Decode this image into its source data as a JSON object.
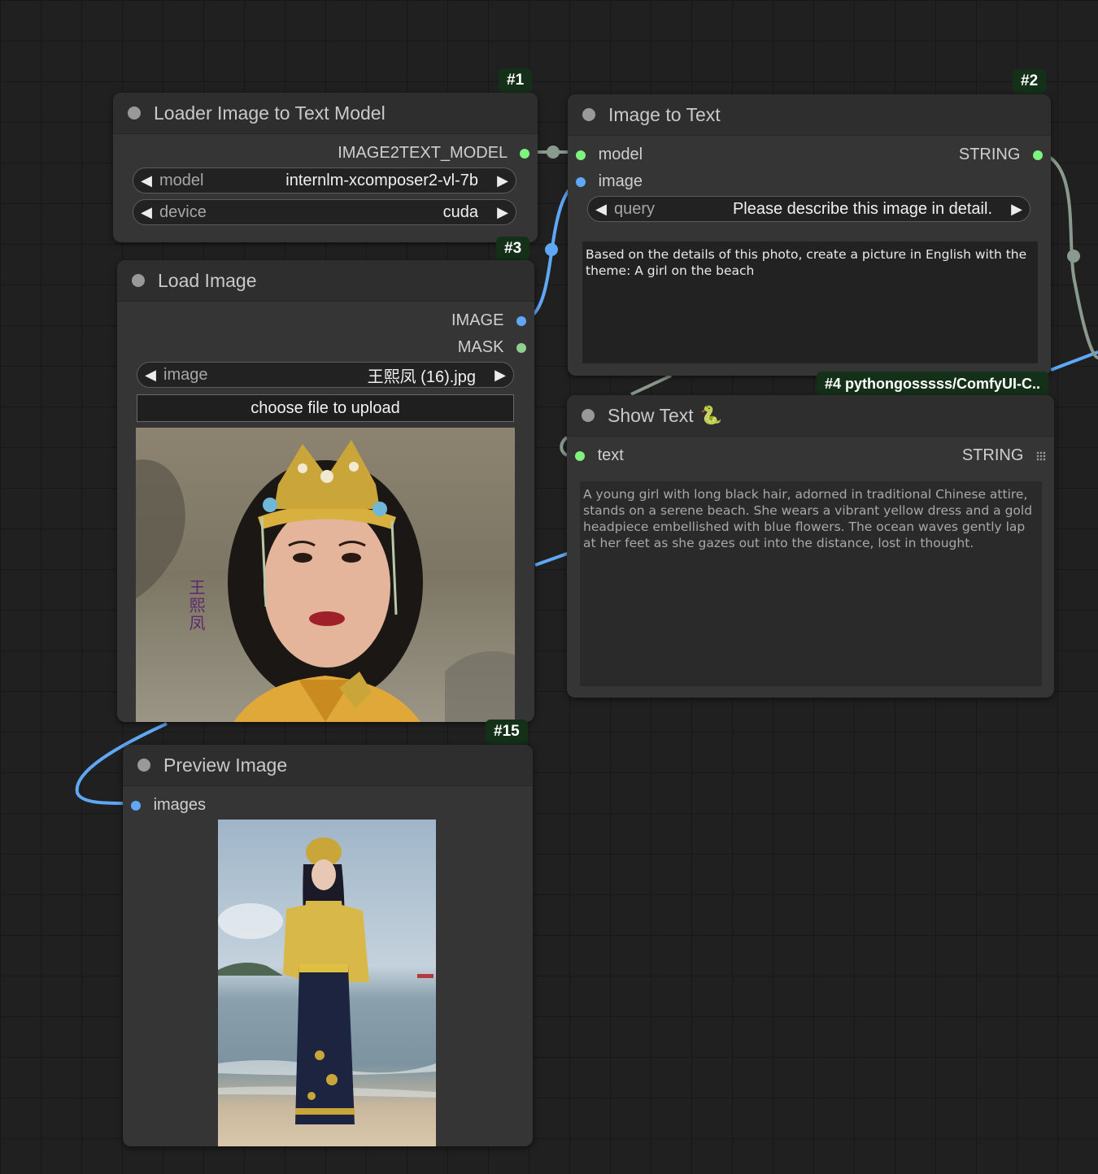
{
  "nodes": {
    "loader": {
      "id": "#1",
      "title": "Loader Image to Text Model",
      "output": "IMAGE2TEXT_MODEL",
      "widgets": [
        {
          "label": "model",
          "value": "internlm-xcomposer2-vl-7b"
        },
        {
          "label": "device",
          "value": "cuda"
        }
      ]
    },
    "image_to_text": {
      "id": "#2",
      "title": "Image to Text",
      "inputs": [
        "model",
        "image"
      ],
      "output": "STRING",
      "query_label": "query",
      "query_value": "Please describe this image in detail.",
      "prompt": "Based on the details of this photo, create a picture in English with the theme: A girl on the beach"
    },
    "load_image": {
      "id": "#3",
      "title": "Load Image",
      "outputs": [
        "IMAGE",
        "MASK"
      ],
      "image_label": "image",
      "image_value": "王熙凤 (16).jpg",
      "upload_label": "choose file to upload",
      "caption": "王熙凤"
    },
    "show_text": {
      "id": "#4",
      "badge": "#4 pythongosssss/ComfyUI-C..",
      "title": "Show Text",
      "title_icon": "🐍",
      "input": "text",
      "output": "STRING",
      "content": "A young girl with long black hair, adorned in traditional Chinese attire, stands on a serene beach. She wears a vibrant yellow dress and a gold headpiece embellished with blue flowers. The ocean waves gently lap at her feet as she gazes out into the distance, lost in thought."
    },
    "preview": {
      "id": "#15",
      "title": "Preview Image",
      "input": "images"
    }
  },
  "colors": {
    "background": "#202020",
    "node": "#353535",
    "badge": "#143018",
    "image_link": "#5fa8f5",
    "model_link": "#8a9a8e",
    "string_link": "#7ef37e"
  }
}
